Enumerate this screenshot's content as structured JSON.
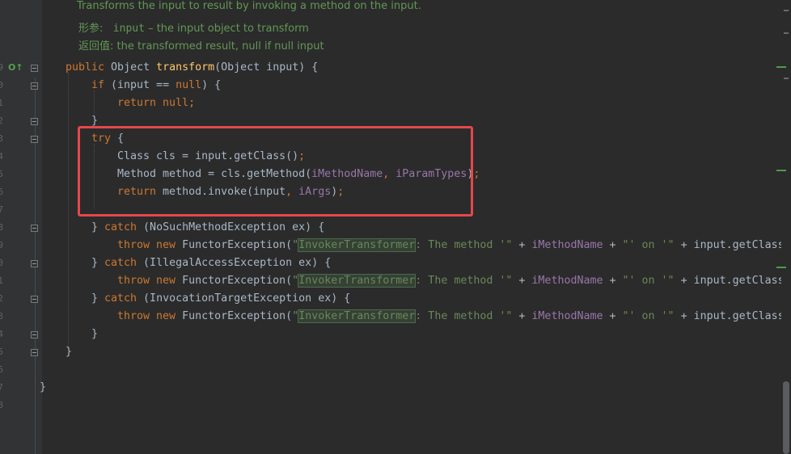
{
  "doc": {
    "summary": "Transforms the input to result by invoking a method on the input.",
    "params_label": "形参:",
    "params_name": "input",
    "params_desc": " – the input object to transform",
    "returns_label": "返回值:",
    "returns_desc": "the transformed result, null if null input"
  },
  "line_numbers": [
    "9",
    "0",
    "1",
    "2",
    "3",
    "4",
    "5",
    "6",
    "7",
    "8",
    "9",
    "0",
    "1",
    "2",
    "3",
    "4",
    "5",
    "6",
    "7",
    "8"
  ],
  "code": {
    "l1": {
      "kw": "public",
      "type": " Object ",
      "fn": "transform",
      "rest": "(Object input) {"
    },
    "l2": {
      "kw": "if",
      "rest1": " (input == ",
      "kw2": "null",
      "rest2": ") {"
    },
    "l3": {
      "kw": "return",
      "kw2": " null",
      "rest": ";"
    },
    "l4": {
      "rest": "}"
    },
    "l5": {
      "kw": "try",
      "rest": " {"
    },
    "l6": {
      "rest1": "Class cls = input.getClass()",
      "semi": ";"
    },
    "l7": {
      "rest1": "Method method = cls.getMethod(",
      "f1": "iMethodName",
      "comma": ", ",
      "f2": "iParamTypes",
      "end": ")",
      "semi": ";"
    },
    "l8": {
      "kw": "return",
      "rest1": " method.invoke(input",
      "comma": ", ",
      "f1": "iArgs",
      "end": ")",
      "semi": ";"
    },
    "l9": {
      "rest1": "} ",
      "kw": "catch",
      "rest2": " (NoSuchMethodException ex) {"
    },
    "l10": {
      "kw": "throw new",
      "rest1": " FunctorException(",
      "q": "\"",
      "hl": "InvokerTransformer",
      "str": ": The method '\"",
      "plus1": " + ",
      "field": "iMethodName",
      "plus2": " + ",
      "str2": "\"' on '\"",
      "tail": " + input.getClass("
    },
    "l11": {
      "rest1": "} ",
      "kw": "catch",
      "rest2": " (IllegalAccessException ex) {"
    },
    "l12": {
      "kw": "throw new",
      "rest1": " FunctorException(",
      "q": "\"",
      "hl": "InvokerTransformer",
      "str": ": The method '\"",
      "plus1": " + ",
      "field": "iMethodName",
      "plus2": " + ",
      "str2": "\"' on '\"",
      "tail": " + input.getClass("
    },
    "l13": {
      "rest1": "} ",
      "kw": "catch",
      "rest2": " (InvocationTargetException ex) {"
    },
    "l14": {
      "kw": "throw new",
      "rest1": " FunctorException(",
      "q": "\"",
      "hl": "InvokerTransformer",
      "str": ": The method '\"",
      "plus1": " + ",
      "field": "iMethodName",
      "plus2": " + ",
      "str2": "\"' on '\"",
      "tail": " + input.getClass("
    },
    "l15": {
      "rest": "}"
    },
    "l16": {
      "rest": "}"
    },
    "l18": {
      "rest": "}"
    }
  },
  "colors": {
    "background": "#2b2b2b",
    "keyword": "#cc7832",
    "method": "#ffc66d",
    "field": "#9876aa",
    "string": "#6a8759",
    "doc": "#629755",
    "annotation_box": "#e5474c"
  }
}
